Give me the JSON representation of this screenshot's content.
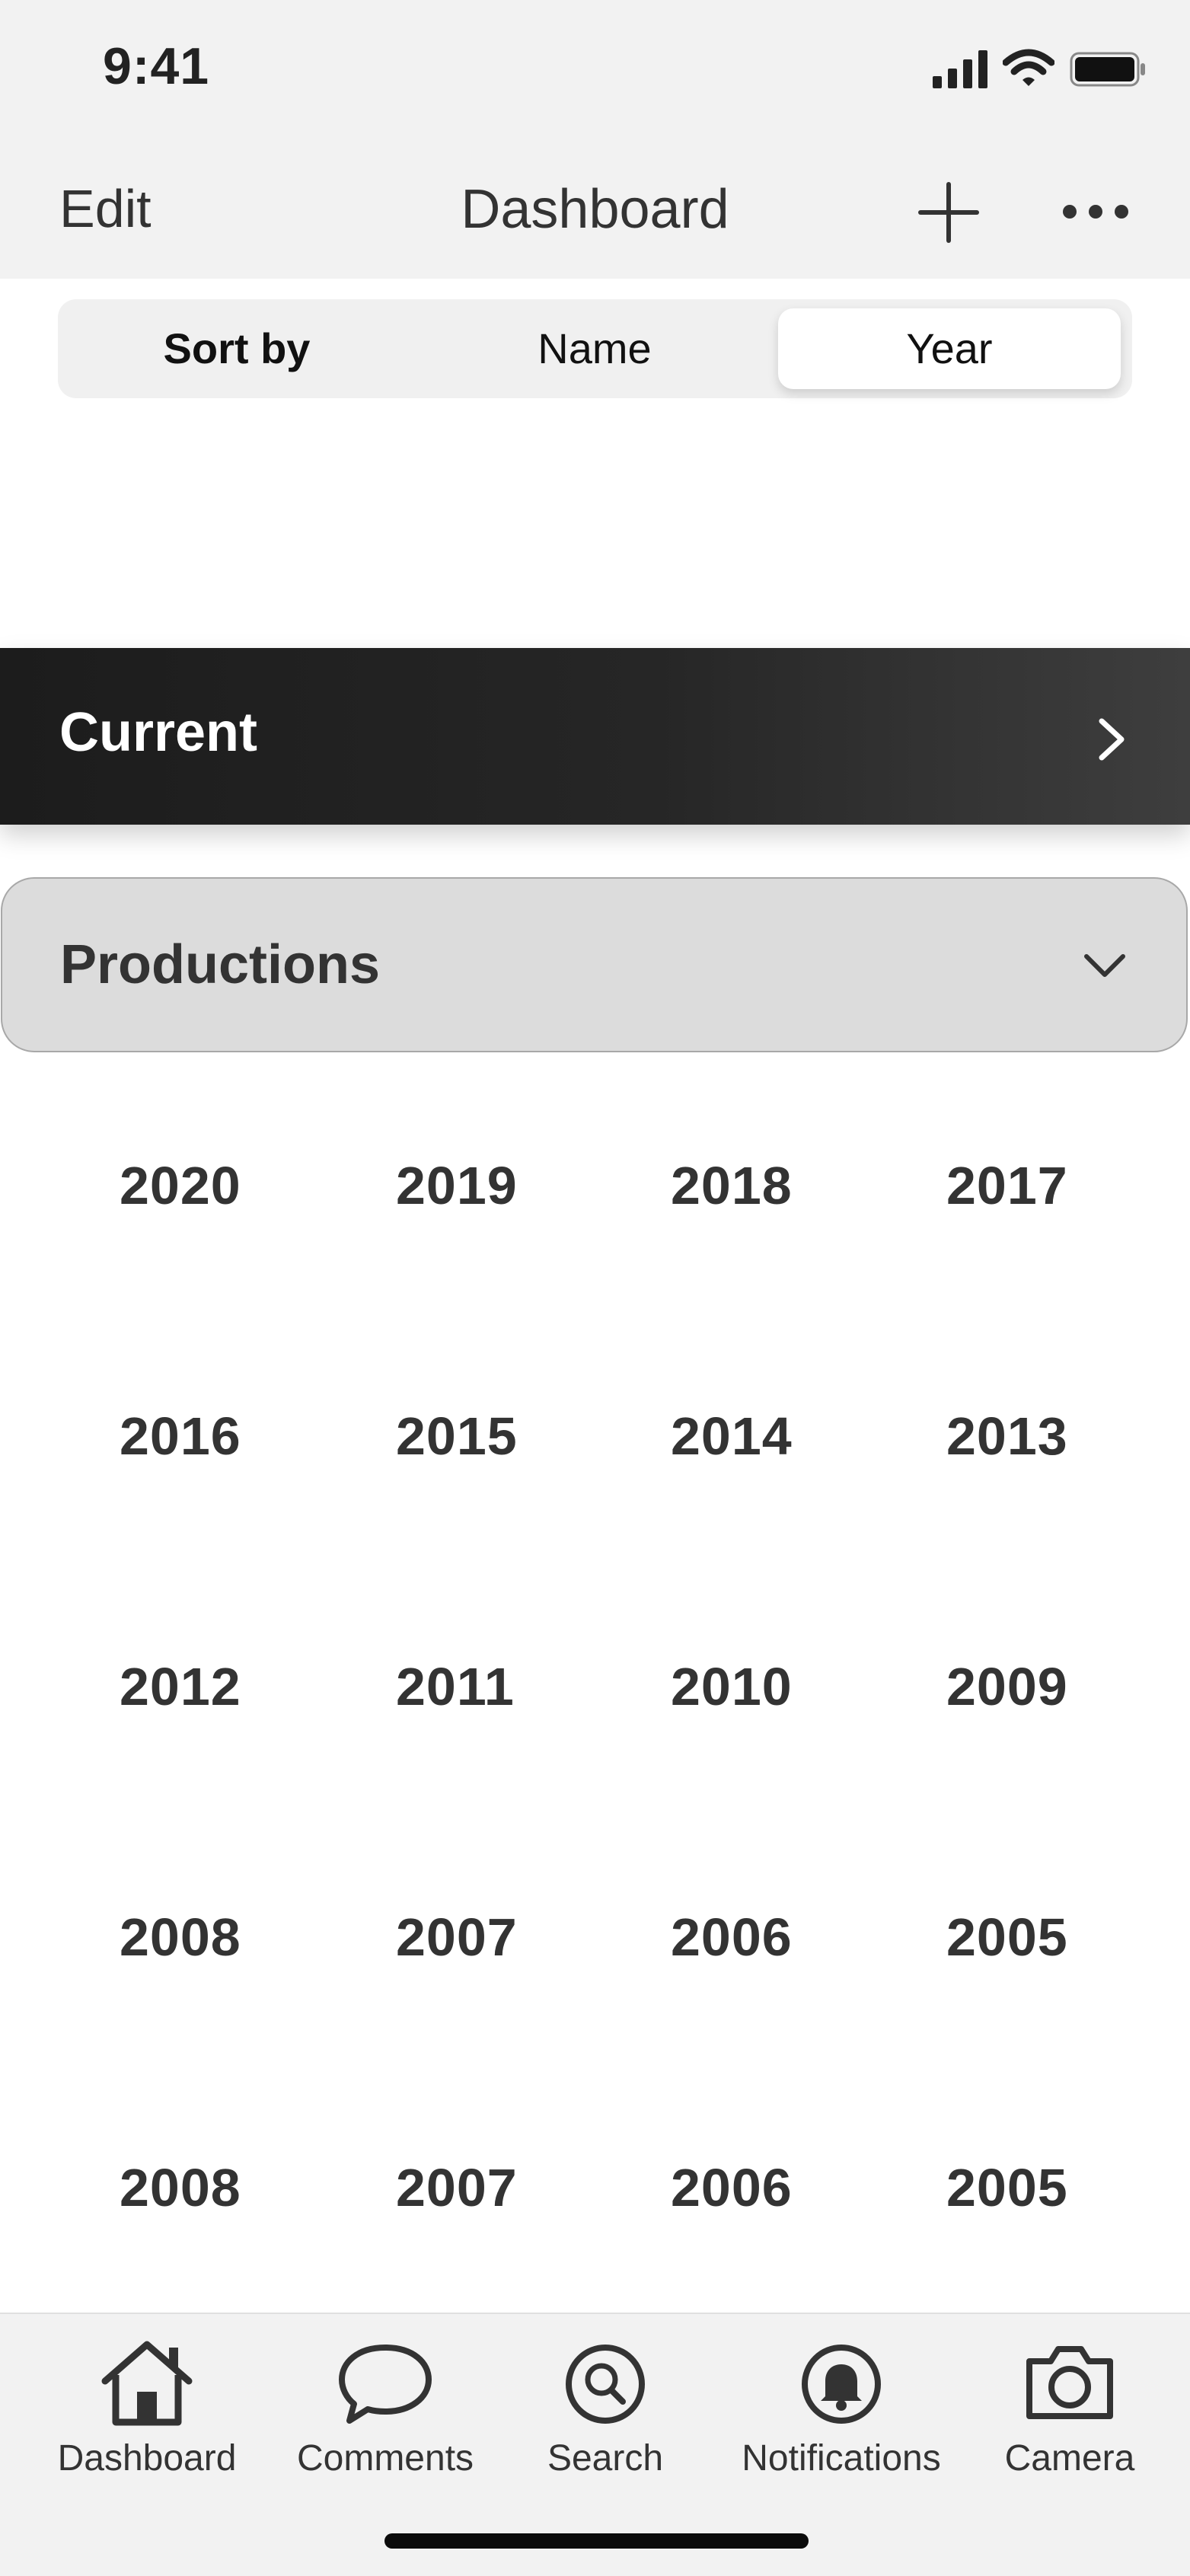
{
  "status_bar": {
    "time": "9:41",
    "icons": [
      "signal-icon",
      "wifi-icon",
      "battery-icon"
    ]
  },
  "nav": {
    "edit_label": "Edit",
    "title": "Dashboard",
    "add_icon": "plus-icon",
    "more_icon": "ellipsis-icon"
  },
  "sort": {
    "label": "Sort by",
    "options": [
      "Name",
      "Year"
    ],
    "selected": "Year"
  },
  "current": {
    "label": "Current",
    "icon": "chevron-right-icon"
  },
  "productions": {
    "label": "Productions",
    "icon": "chevron-down-icon",
    "expanded": true
  },
  "years": [
    [
      "2020",
      "2019",
      "2018",
      "2017"
    ],
    [
      "2016",
      "2015",
      "2014",
      "2013"
    ],
    [
      "2012",
      "2011",
      "2010",
      "2009"
    ],
    [
      "2008",
      "2007",
      "2006",
      "2005"
    ],
    [
      "2008",
      "2007",
      "2006",
      "2005"
    ]
  ],
  "tabs": [
    {
      "label": "Dashboard",
      "icon": "home-icon"
    },
    {
      "label": "Comments",
      "icon": "speech-bubble-icon"
    },
    {
      "label": "Search",
      "icon": "search-icon"
    },
    {
      "label": "Notifications",
      "icon": "bell-icon"
    },
    {
      "label": "Camera",
      "icon": "camera-icon"
    }
  ],
  "colors": {
    "chrome_bg": "#f2f2f2",
    "banner_dark": "#1c1c1c",
    "accordion_bg": "#dcdcdc",
    "text": "#333333"
  }
}
